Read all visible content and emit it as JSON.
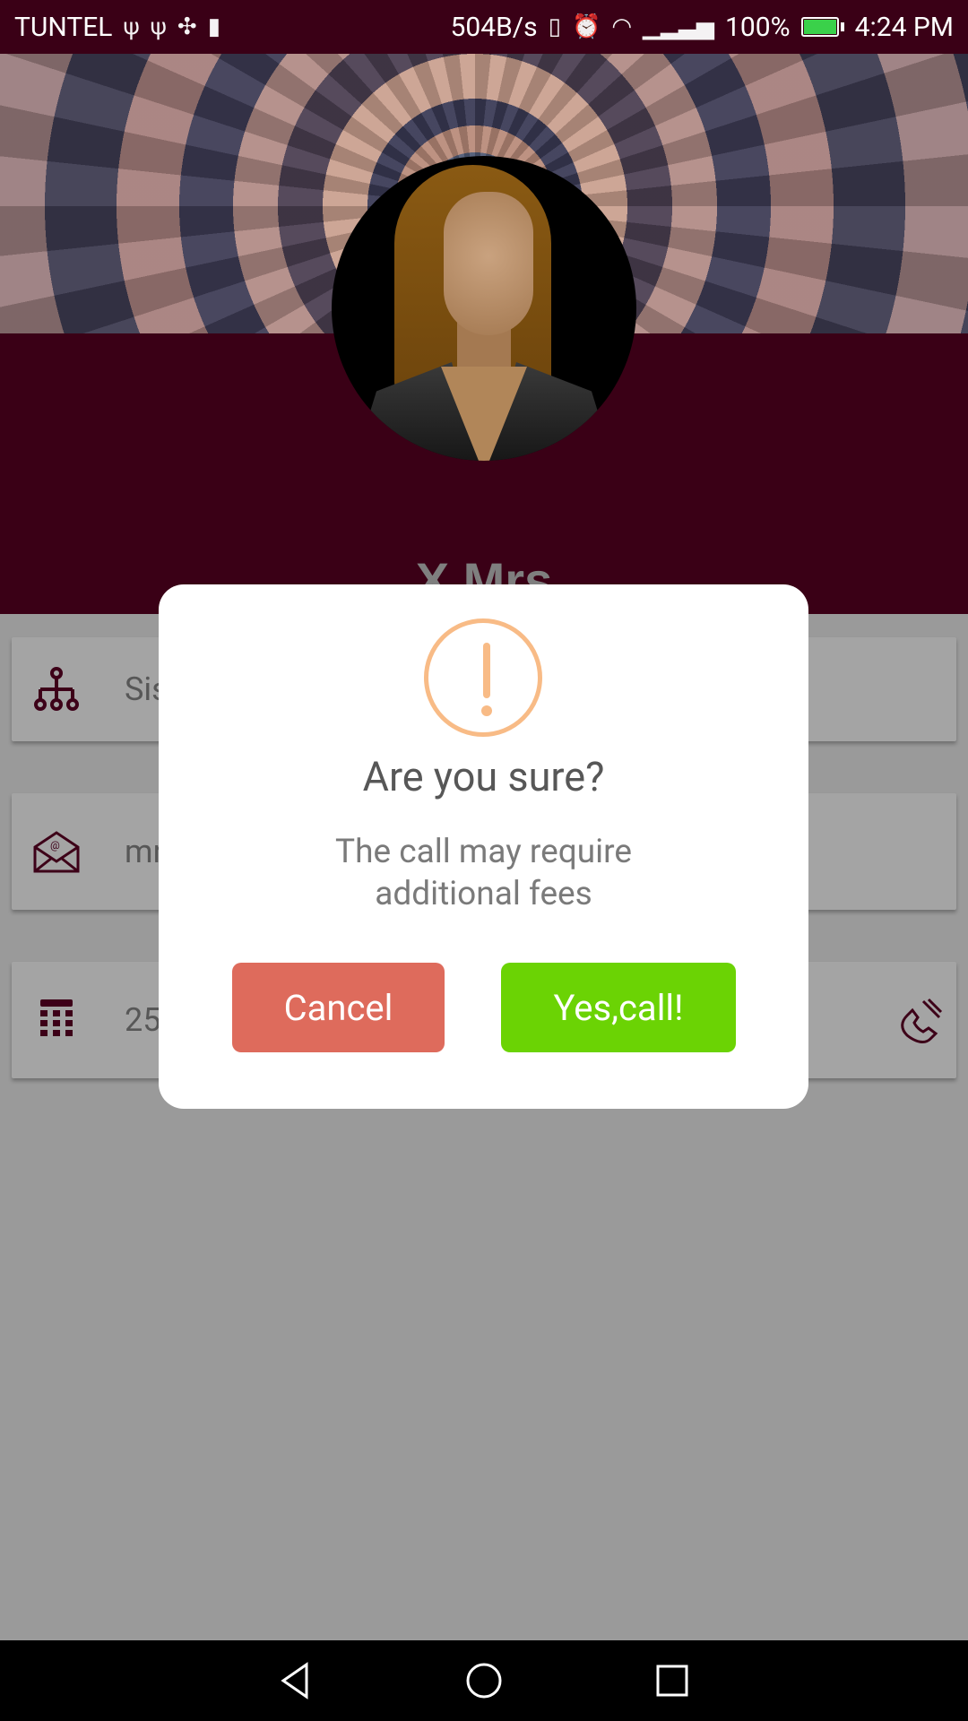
{
  "status_bar": {
    "carrier": "TUNTEL",
    "left_icons": [
      "usb-icon",
      "usb-icon",
      "sync-icon",
      "lock-icon"
    ],
    "net_speed": "504B/s",
    "battery_percent": "100%",
    "time": "4:24 PM"
  },
  "profile": {
    "name": "X Mrs"
  },
  "contact_rows": [
    {
      "icon": "org-chart-icon",
      "text": "Sis"
    },
    {
      "icon": "email-icon",
      "text": "mr"
    },
    {
      "icon": "phone-icon",
      "text": "25",
      "action_icon": "call-icon"
    }
  ],
  "dialog": {
    "title": "Are you sure?",
    "message_line1": "The call may require",
    "message_line2": "additional fees",
    "cancel_label": "Cancel",
    "confirm_label": "Yes,call!"
  },
  "colors": {
    "header": "#3a0016",
    "cancel": "#de6b5c",
    "confirm": "#6bd304",
    "warning": "#f8bb86"
  },
  "nav": [
    "back-icon",
    "home-icon",
    "recents-icon"
  ]
}
